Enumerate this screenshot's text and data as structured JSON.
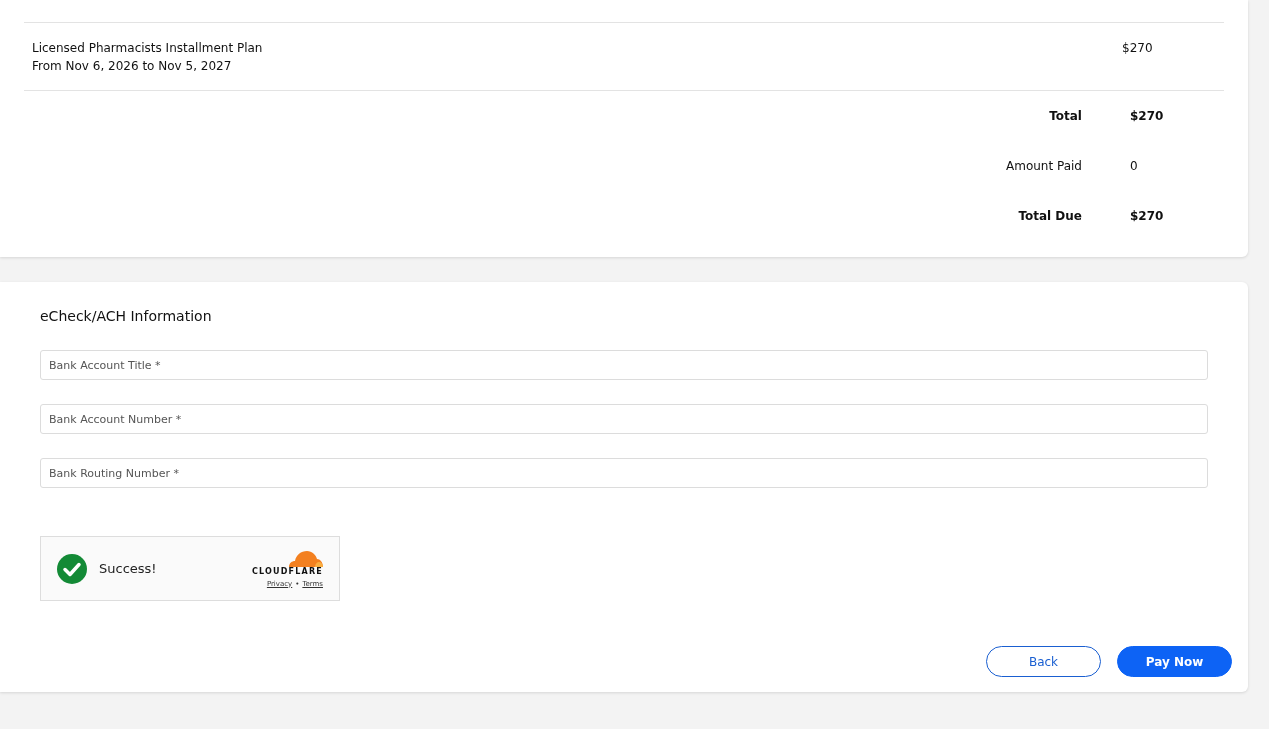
{
  "invoice": {
    "items": [
      {
        "name": "Licensed Pharmacists Installment Plan",
        "period": "From Nov 6, 2026 to Nov 5, 2027",
        "amount": "$270"
      }
    ],
    "summary": [
      {
        "label": "Total",
        "value": "$270",
        "bold": true
      },
      {
        "label": "Amount Paid",
        "value": "0",
        "bold": false
      },
      {
        "label": "Total Due",
        "value": "$270",
        "bold": true
      }
    ]
  },
  "payment": {
    "title": "eCheck/ACH Information",
    "fields": [
      {
        "placeholder": "Bank Account Title *"
      },
      {
        "placeholder": "Bank Account Number *"
      },
      {
        "placeholder": "Bank Routing Number *"
      }
    ],
    "captcha": {
      "status": "Success!",
      "brand": "CLOUDFLARE",
      "links": [
        "Privacy",
        "Terms"
      ],
      "separator": "•"
    },
    "buttons": [
      {
        "label": "Back",
        "kind": "secondary"
      },
      {
        "label": "Pay Now",
        "kind": "primary"
      }
    ]
  }
}
